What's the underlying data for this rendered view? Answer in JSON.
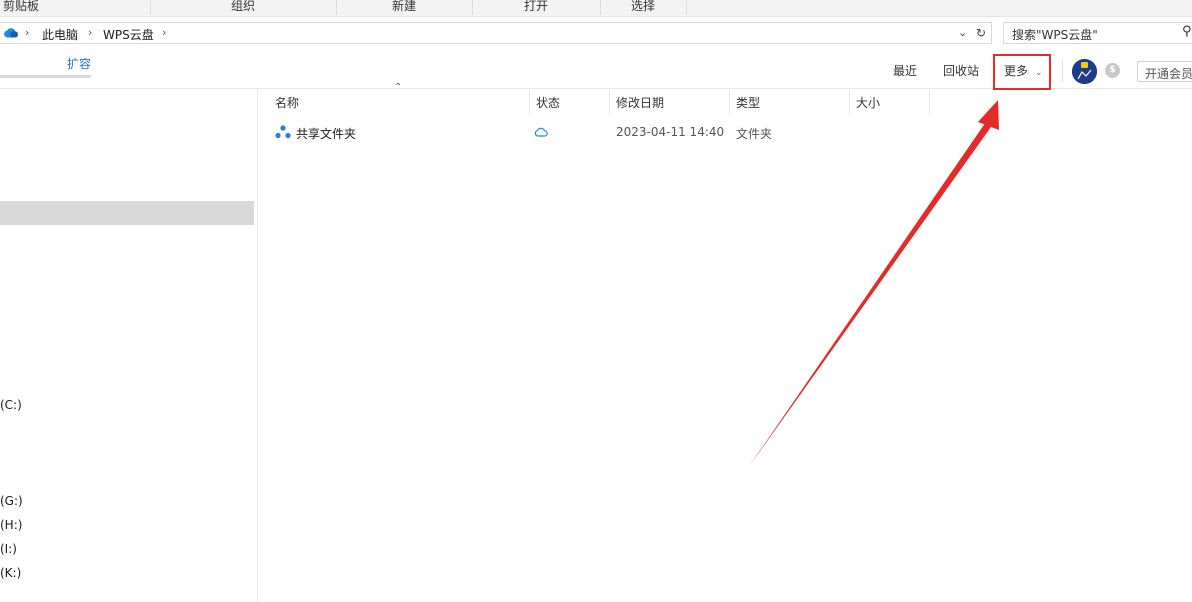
{
  "ribbon": {
    "groups": [
      "剪贴板",
      "组织",
      "新建",
      "打开",
      "选择"
    ]
  },
  "address": {
    "breadcrumbs": [
      "此电脑",
      "WPS云盘"
    ],
    "search_placeholder": "搜索\"WPS云盘\""
  },
  "toolbar": {
    "expand_label": "扩容",
    "recent_label": "最近",
    "recycle_label": "回收站",
    "more_label": "更多",
    "vip_label": "开通会员"
  },
  "nav": {
    "drives": [
      "(C:)",
      "(G:)",
      "(H:)",
      "(I:)",
      "(K:)"
    ]
  },
  "table": {
    "columns": [
      "名称",
      "状态",
      "修改日期",
      "类型",
      "大小"
    ],
    "rows": [
      {
        "name": "共享文件夹",
        "status_icon": "cloud-icon",
        "date": "2023-04-11 14:40",
        "type": "文件夹",
        "size": ""
      }
    ]
  },
  "annotation": {
    "highlight_color": "#e52a2a"
  },
  "colors": {
    "accent": "#2a6fd6",
    "selected_nav": "#d9d9d9"
  }
}
